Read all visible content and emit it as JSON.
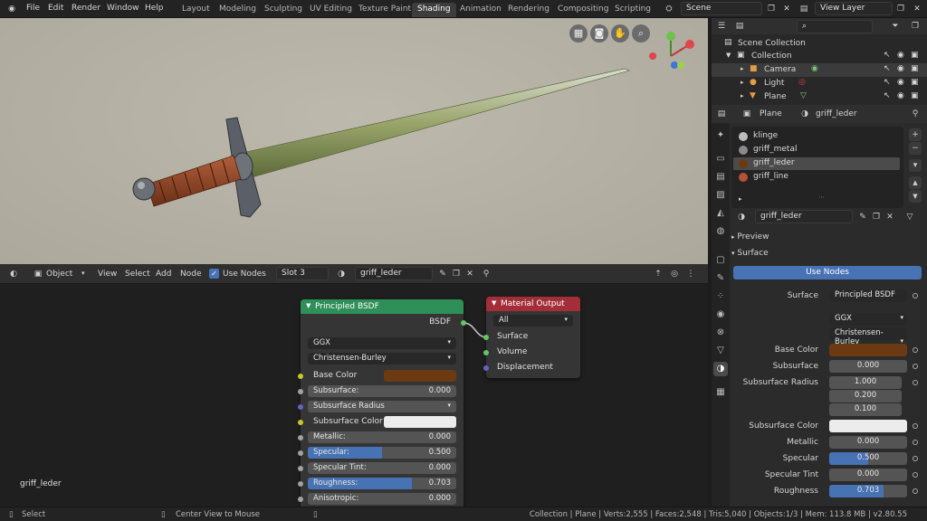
{
  "topbar": {
    "menus": [
      "File",
      "Edit",
      "Render",
      "Window",
      "Help"
    ],
    "workspaces": [
      "Layout",
      "Modeling",
      "Sculpting",
      "UV Editing",
      "Texture Paint",
      "Shading",
      "Animation",
      "Rendering",
      "Compositing",
      "Scripting"
    ],
    "active_workspace": "Shading",
    "scene": "Scene",
    "view_layer": "View Layer"
  },
  "node_header": {
    "mode": "Object",
    "menus": [
      "View",
      "Select",
      "Add",
      "Node"
    ],
    "use_nodes_label": "Use Nodes",
    "slot": "Slot 3",
    "material": "griff_leder"
  },
  "node_canvas": {
    "material_label": "griff_leder",
    "principled": {
      "title": "Principled BSDF",
      "output": "BSDF",
      "distribution": "GGX",
      "subsurface_method": "Christensen-Burley",
      "base_color_label": "Base Color",
      "base_color": "#6b3a12",
      "subsurface": {
        "label": "Subsurface:",
        "value": "0.000"
      },
      "subsurface_radius": "Subsurface Radius",
      "subsurface_color_label": "Subsurface Color",
      "metallic": {
        "label": "Metallic:",
        "value": "0.000"
      },
      "specular": {
        "label": "Specular:",
        "value": "0.500",
        "fraction": 0.5
      },
      "specular_tint": {
        "label": "Specular Tint:",
        "value": "0.000"
      },
      "roughness": {
        "label": "Roughness:",
        "value": "0.703",
        "fraction": 0.703
      },
      "anisotropic": {
        "label": "Anisotropic:",
        "value": "0.000"
      }
    },
    "output_node": {
      "title": "Material Output",
      "target": "All",
      "inputs": [
        "Surface",
        "Volume",
        "Displacement"
      ]
    }
  },
  "outliner": {
    "root": "Scene Collection",
    "collection": "Collection",
    "items": [
      "Camera",
      "Light",
      "Plane"
    ]
  },
  "properties": {
    "object": "Plane",
    "material": "griff_leder",
    "slots": [
      {
        "name": "klinge",
        "color": "#bdbdbd"
      },
      {
        "name": "griff_metal",
        "color": "#8a8a8a"
      },
      {
        "name": "griff_leder",
        "color": "#6b3a12"
      },
      {
        "name": "griff_line",
        "color": "#b5503a"
      }
    ],
    "selected_slot": "griff_leder",
    "panels": {
      "preview": "Preview",
      "surface": "Surface"
    },
    "use_nodes": "Use Nodes",
    "surface_label": "Surface",
    "surface_value": "Principled BSDF",
    "distribution": "GGX",
    "subsurface_method": "Christensen-Burley",
    "base_color_label": "Base Color",
    "subsurface": {
      "label": "Subsurface",
      "value": "0.000"
    },
    "subsurface_radius": {
      "label": "Subsurface Radius",
      "values": [
        "1.000",
        "0.200",
        "0.100"
      ]
    },
    "subsurface_color_label": "Subsurface Color",
    "metallic": {
      "label": "Metallic",
      "value": "0.000"
    },
    "specular": {
      "label": "Specular",
      "value": "0.500",
      "fraction": 0.5
    },
    "specular_tint": {
      "label": "Specular Tint",
      "value": "0.000"
    },
    "roughness": {
      "label": "Roughness",
      "value": "0.703",
      "fraction": 0.703
    }
  },
  "statusbar": {
    "left": "Select",
    "middle": "Center View to Mouse",
    "right": "Collection | Plane | Verts:2,555 | Faces:2,548 | Tris:5,040 | Objects:1/3 | Mem: 113.8 MB | v2.80.55"
  }
}
